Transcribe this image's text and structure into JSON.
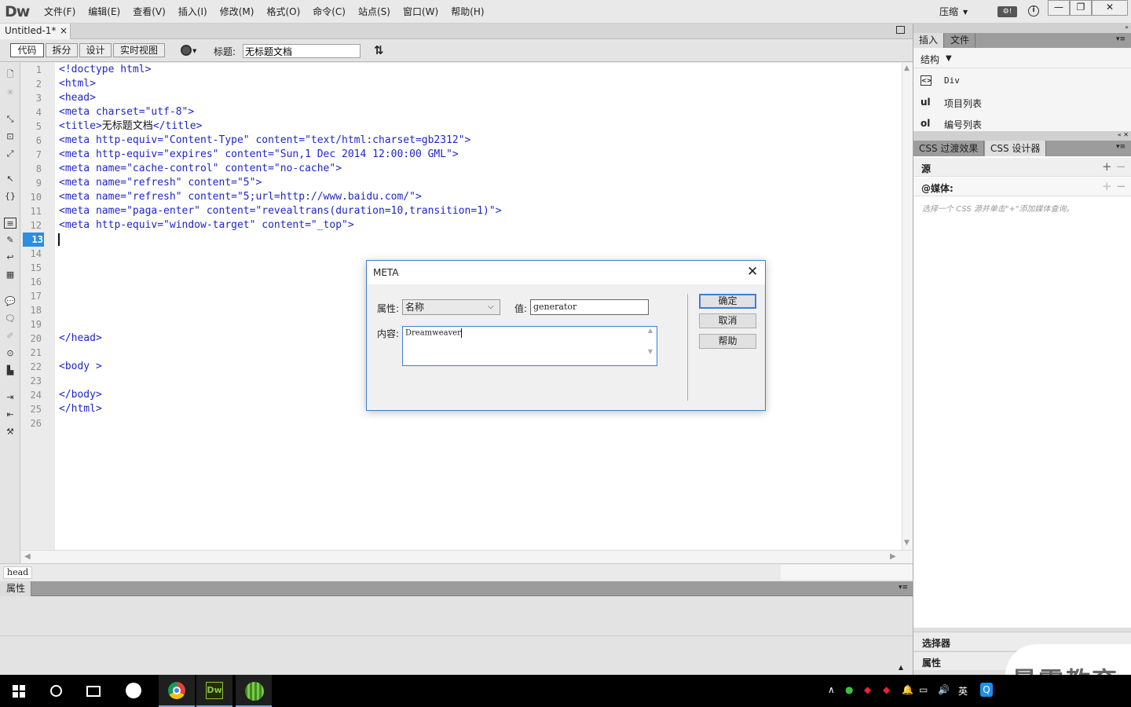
{
  "app": {
    "logo": "Dw",
    "menus": [
      "文件(F)",
      "编辑(E)",
      "查看(V)",
      "插入(I)",
      "修改(M)",
      "格式(O)",
      "命令(C)",
      "站点(S)",
      "窗口(W)",
      "帮助(H)"
    ],
    "workspace": "压缩",
    "window_controls": {
      "minimize": "—",
      "maximize": "❐",
      "close": "✕"
    }
  },
  "document": {
    "tab_name": "Untitled-1*",
    "tab_close": "×",
    "view_buttons": [
      "代码",
      "拆分",
      "设计",
      "实时视图"
    ],
    "active_view": "代码",
    "title_label": "标题:",
    "title_value": "无标题文档"
  },
  "code": {
    "current_line": 13,
    "lines": [
      "<!doctype html>",
      "<html>",
      "<head>",
      "<meta charset=\"utf-8\">",
      "<title>无标题文档</title>",
      "<meta http-equiv=\"Content-Type\" content=\"text/html:charset=gb2312\">",
      "<meta http-equiv=\"expires\" content=\"Sun,1 Dec 2014 12:00:00 GML\">",
      "<meta name=\"cache-control\" content=\"no-cache\">",
      "<meta name=\"refresh\" content=\"5\">",
      "<meta name=\"refresh\" content=\"5;url=http://www.baidu.com/\">",
      "<meta name=\"paga-enter\" content=\"revealtrans(duration=10,transition=1)\">",
      "<meta http-equiv=\"window-target\" content=\"_top\">",
      "",
      "",
      "",
      "",
      "",
      "",
      "",
      "</head>",
      "",
      "<body >",
      "",
      "</body>",
      "</html>",
      ""
    ]
  },
  "status": {
    "tag_selector": "head"
  },
  "properties": {
    "title": "属性"
  },
  "right_panel": {
    "tabs_top": [
      "插入",
      "文件"
    ],
    "structure_label": "结构",
    "insert_items": [
      {
        "icon": "<>",
        "label": "Div"
      },
      {
        "icon": "ul",
        "label": "项目列表"
      },
      {
        "icon": "ol",
        "label": "编号列表"
      }
    ],
    "tabs_css": [
      "CSS 过渡效果",
      "CSS 设计器"
    ],
    "css_sources": "源",
    "css_media": "@媒体:",
    "css_hint": "选择一个 CSS 源并单击\"+\"添加媒体查询。",
    "selectors": "选择器",
    "properties": "属性"
  },
  "dialog": {
    "title": "META",
    "attr_label": "属性:",
    "attr_value": "名称",
    "value_label": "值:",
    "value_text": "generator",
    "content_label": "内容:",
    "content_text": "Dreamweaver",
    "buttons": {
      "ok": "确定",
      "cancel": "取消",
      "help": "帮助"
    }
  },
  "taskbar": {
    "ime": "英"
  },
  "watermark": "最需教育"
}
